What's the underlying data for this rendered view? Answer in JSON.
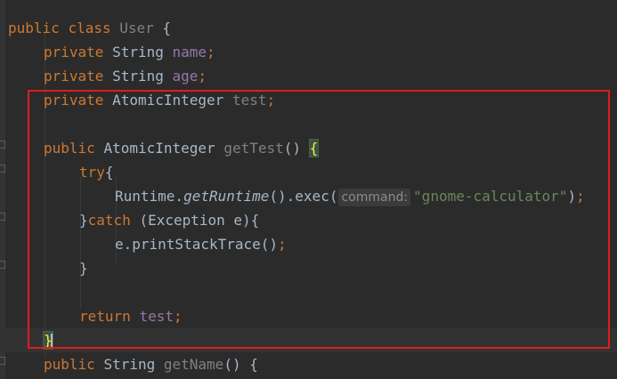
{
  "code": {
    "line1": {
      "kw1": "public",
      "kw2": "class",
      "name": "User",
      "brace": "{"
    },
    "line2": {
      "kw": "private",
      "type": "String",
      "field": "name",
      "semi": ";"
    },
    "line3": {
      "kw": "private",
      "type": "String",
      "field": "age",
      "semi": ";"
    },
    "line4": {
      "kw": "private",
      "type": "AtomicInteger",
      "field": "test",
      "semi": ";"
    },
    "line6": {
      "kw": "public",
      "type": "AtomicInteger",
      "method": "getTest",
      "parens": "()",
      "brace": "{"
    },
    "line7": {
      "kw": "try",
      "brace": "{"
    },
    "line8": {
      "cls": "Runtime.",
      "method": "getRuntime",
      "mid": "().exec(",
      "hint": "command:",
      "string": "\"gnome-calculator\"",
      "close": ")",
      "semi": ";"
    },
    "line9": {
      "close": "}",
      "kw": "catch",
      "args": " (Exception e){"
    },
    "line10": {
      "text": "e.printStackTrace()",
      "semi": ";"
    },
    "line11": {
      "brace": "}"
    },
    "line13": {
      "kw": "return",
      "field": "test",
      "semi": ";"
    },
    "line14": {
      "brace": "}"
    },
    "line15": {
      "kw": "public",
      "type": "String",
      "method": "getName",
      "parens": "()",
      "brace": "{"
    }
  },
  "colors": {
    "background": "#2b2b2b",
    "keyword": "#cc7832",
    "field": "#9876aa",
    "string": "#6a8759",
    "highlight_border": "#e21a1a"
  }
}
